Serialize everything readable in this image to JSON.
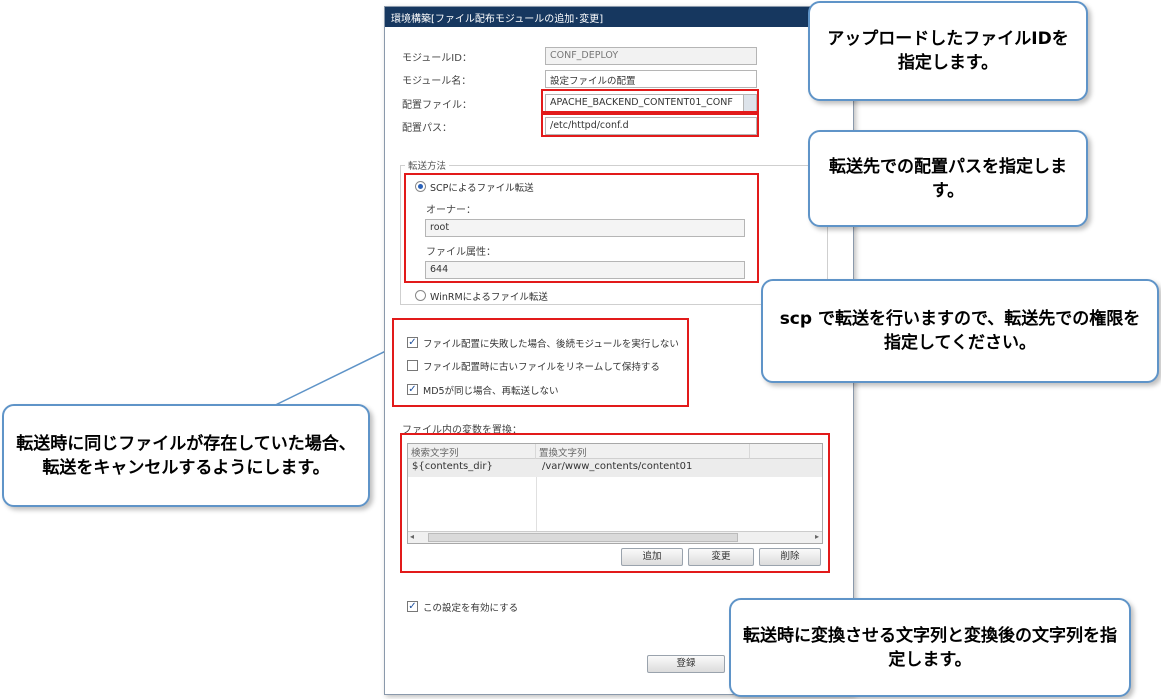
{
  "dialog": {
    "title": "環境構築[ファイル配布モジュールの追加･変更]",
    "module_id_label": "モジュールID：",
    "module_id_value": "CONF_DEPLOY",
    "module_name_label": "モジュール名：",
    "module_name_value": "設定ファイルの配置",
    "deploy_file_label": "配置ファイル：",
    "deploy_file_value": "APACHE_BACKEND_CONTENT01_CONF",
    "deploy_path_label": "配置パス：",
    "deploy_path_value": "/etc/httpd/conf.d",
    "transfer": {
      "legend": "転送方法",
      "scp_label": "SCPによるファイル転送",
      "scp_selected": true,
      "owner_label": "オーナー：",
      "owner_value": "root",
      "attr_label": "ファイル属性：",
      "attr_value": "644",
      "winrm_label": "WinRMによるファイル転送"
    },
    "options": {
      "opt1": "ファイル配置に失敗した場合、後続モジュールを実行しない",
      "opt1_checked": true,
      "opt2": "ファイル配置時に古いファイルをリネームして保持する",
      "opt2_checked": false,
      "opt3": "MD5が同じ場合、再転送しない",
      "opt3_checked": true
    },
    "replace": {
      "label": "ファイル内の変数を置換：",
      "col_search": "検索文字列",
      "col_replace": "置換文字列",
      "rows": [
        {
          "search": "${contents_dir}",
          "replace": "/var/www_contents/content01"
        }
      ],
      "add_button": "追加",
      "edit_button": "変更",
      "delete_button": "削除"
    },
    "enable_label": "この設定を有効にする",
    "enable_checked": true,
    "register_button": "登録"
  },
  "callouts": {
    "file_id": "アップロードしたファイルIDを指定します。",
    "path": "転送先での配置パスを指定します。",
    "scp": "scp で転送を行いますので、転送先での権限を指定してください。",
    "cancel": "転送時に同じファイルが存在していた場合、転送をキャンセルするようにします。",
    "replace": "転送時に変換させる文字列と変換後の文字列を指定します。"
  }
}
